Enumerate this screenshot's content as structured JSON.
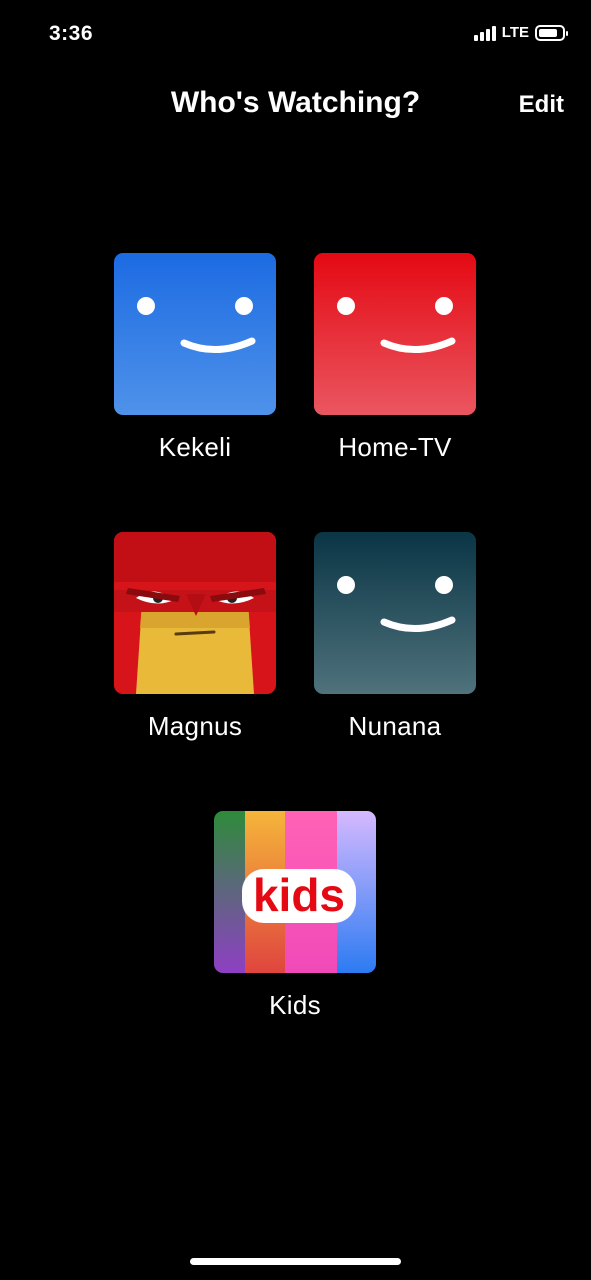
{
  "status_bar": {
    "time": "3:36",
    "network": "LTE",
    "icons": [
      "signal-icon",
      "battery-icon"
    ]
  },
  "header": {
    "title": "Who's Watching?",
    "edit_label": "Edit"
  },
  "profiles": [
    {
      "name": "Kekeli",
      "avatar": "smiley-face-icon",
      "colors": [
        "#1f6fe3",
        "#4a90ea"
      ]
    },
    {
      "name": "Home-TV",
      "avatar": "smiley-face-icon",
      "colors": [
        "#e50914",
        "#e9515a"
      ]
    },
    {
      "name": "Magnus",
      "avatar": "angry-red-character-icon",
      "colors": [
        "#e01e1e",
        "#f2c93c"
      ]
    },
    {
      "name": "Nunana",
      "avatar": "smiley-face-icon",
      "colors": [
        "#0d3848",
        "#4a6f7a"
      ]
    },
    {
      "name": "Kids",
      "avatar": "kids-logo-icon",
      "logo_text": "kids",
      "colors": [
        "#3a8c3a",
        "#f5b83d",
        "#ff5db1",
        "#d4b5ff"
      ]
    }
  ],
  "colors": {
    "background": "#000000",
    "text": "#ffffff",
    "kids_logo_red": "#e50914"
  }
}
